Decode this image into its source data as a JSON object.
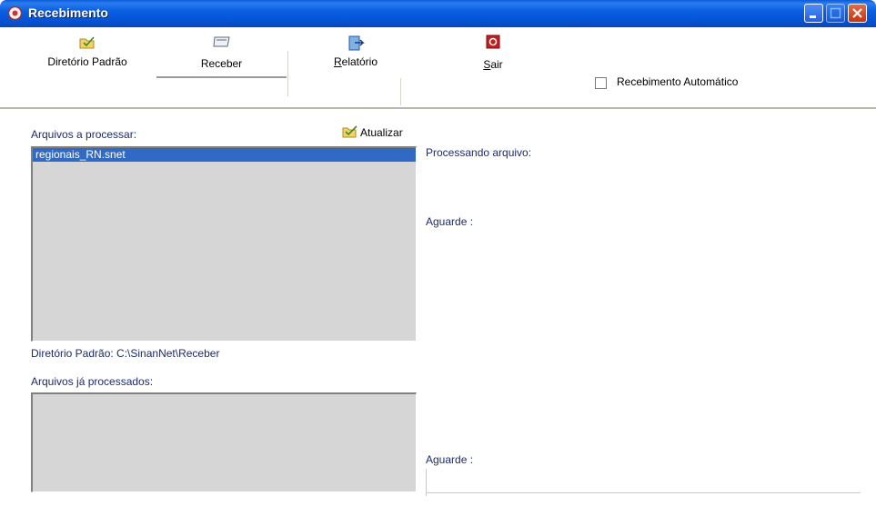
{
  "window": {
    "title": "Recebimento"
  },
  "toolbar": {
    "items": [
      {
        "label": "Diretório Padrão",
        "icon": "folder-icon"
      },
      {
        "label": "Receber",
        "icon": "inbox-icon"
      },
      {
        "label_access": "R",
        "label_rest": "elatório",
        "icon": "report-icon"
      },
      {
        "label_access": "S",
        "label_rest": "air",
        "icon": "stop-icon"
      }
    ],
    "auto_receive_label": "Recebimento Automático",
    "auto_receive_checked": false
  },
  "left": {
    "pending_label": "Arquivos a processar:",
    "refresh_label": "Atualizar",
    "pending_files": [
      "regionais_RN.snet"
    ],
    "default_dir": "Diretório Padrão: C:\\SinanNet\\Receber",
    "processed_label": "Arquivos já processados:",
    "processed_files": []
  },
  "right": {
    "processing_label": "Processando arquivo:",
    "wait_label_1": "Aguarde :",
    "wait_label_2": "Aguarde :"
  },
  "colors": {
    "titlebar": "#0553d6",
    "selection": "#316ac5",
    "list_bg": "#d6d6d6",
    "label_text": "#1c2a6e"
  }
}
